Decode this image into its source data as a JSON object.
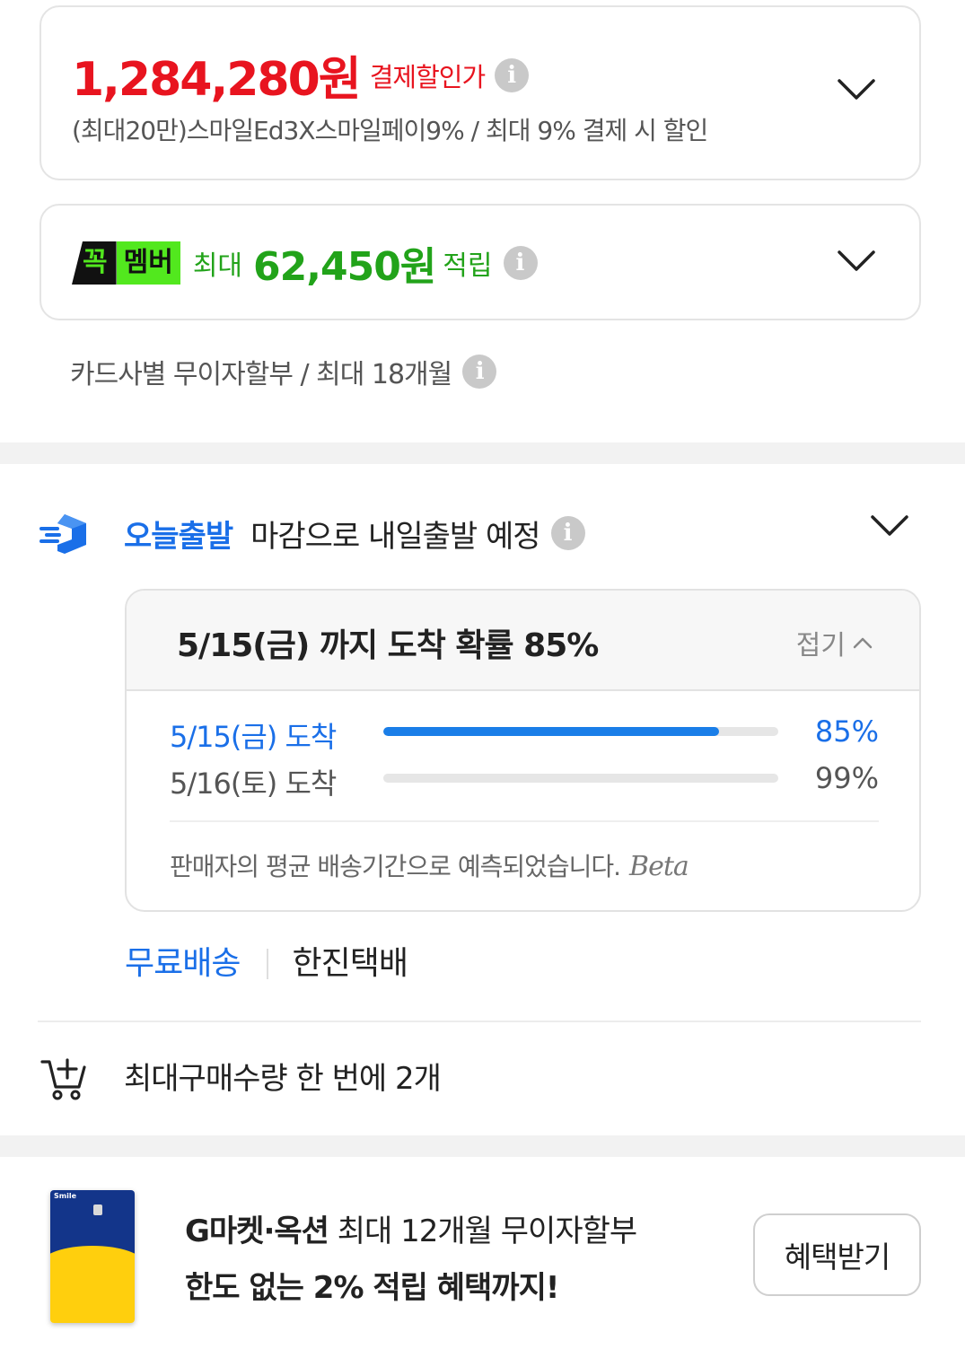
{
  "price_card": {
    "amount": "1,284,280원",
    "label": "결제할인가",
    "description": "(최대20만)스마일Ed3X스마일페이9% / 최대 9% 결제 시 할인"
  },
  "member_card": {
    "badge_part1": "꼭",
    "badge_part2": "멤버",
    "prefix": "최대",
    "amount": "62,450원",
    "suffix": "적립"
  },
  "installment": {
    "text": "카드사별 무이자할부 / 최대 18개월"
  },
  "delivery": {
    "tag": "오늘출발",
    "text": "마감으로 내일출발 예정",
    "probability_box": {
      "title": "5/15(금) 까지 도착 확률 85%",
      "fold_label": "접기",
      "rows": [
        {
          "date": "5/15(금) 도착",
          "percent_label": "85%",
          "percent": 85
        },
        {
          "date": "5/16(토) 도착",
          "percent_label": "99%",
          "percent": 99
        }
      ],
      "note": "판매자의 평균 배송기간으로 예측되었습니다.",
      "beta": "Beta"
    },
    "free_shipping": "무료배송",
    "courier": "한진택배"
  },
  "max_purchase": {
    "text": "최대구매수량 한 번에 2개"
  },
  "promo": {
    "brand": "G마켓·옥션",
    "line1_rest": " 최대 12개월 무이자할부",
    "line2": "한도 없는 2% 적립 혜택까지!",
    "button_label": "혜택받기",
    "card_logo": "Smile"
  },
  "colors": {
    "price_red": "#e8141f",
    "member_green": "#22a31a",
    "accent_blue": "#1a6fe8",
    "badge_green": "#52e81e"
  },
  "icons": {
    "info": "info-icon",
    "chevron": "chevron-down-icon",
    "truck": "fast-delivery-icon",
    "cart": "cart-plus-icon"
  }
}
